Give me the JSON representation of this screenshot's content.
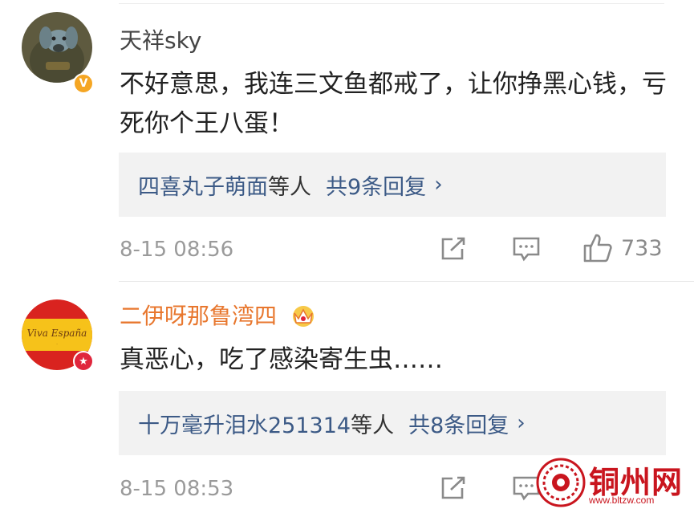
{
  "comments": [
    {
      "username": "天祥sky",
      "text": "不好意思，我连三文鱼都戒了，让你挣黑心钱，亏死你个王八蛋！",
      "reply_names": "四喜丸子萌面",
      "reply_suffix": "等人",
      "reply_count": "共9条回复",
      "chevron": "›",
      "time": "8-15 08:56",
      "likes": "733",
      "badge": "V",
      "username_color": "#444444"
    },
    {
      "username": "二伊呀那鲁湾四",
      "text": "真恶心，吃了感染寄生虫……",
      "reply_names": "十万毫升泪水251314",
      "reply_suffix": "等人",
      "reply_count": "共8条回复",
      "chevron": "›",
      "time": "8-15 08:53",
      "badge": "★",
      "username_color": "#e8772e",
      "avatar_text": "Viva España"
    }
  ],
  "watermark": {
    "title": "铜州网",
    "url": "www.bltzw.com"
  },
  "colors": {
    "link": "#3c5a86",
    "muted": "#9a9a9a",
    "badge_v": "#f5a623",
    "badge_star": "#e0263c",
    "brand_red": "#c9151e"
  },
  "icons": [
    "share-icon",
    "comment-icon",
    "like-icon",
    "crown-icon"
  ]
}
